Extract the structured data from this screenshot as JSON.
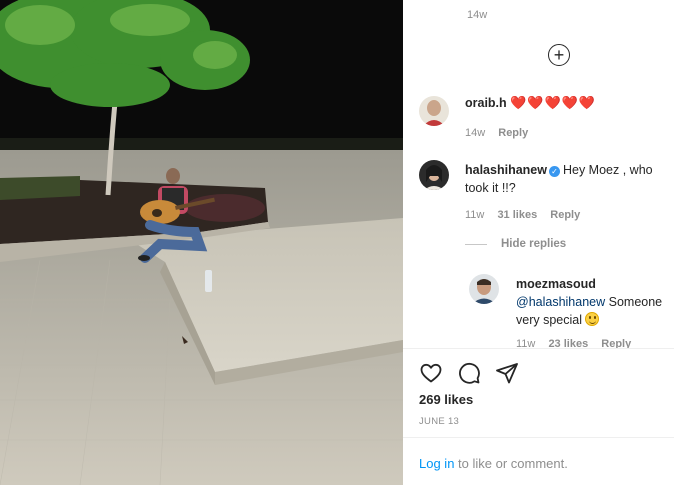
{
  "post": {
    "likes_count": "269 likes",
    "date": "JUNE 13"
  },
  "comments_panel": {
    "top_timestamp": "14w",
    "comments": [
      {
        "username": "oraib.h",
        "text": "❤️❤️❤️❤️❤️",
        "timestamp": "14w",
        "reply_label": "Reply"
      },
      {
        "username": "halashihanew",
        "verified": true,
        "text": "Hey Moez , who took it !!?",
        "timestamp": "11w",
        "likes": "31 likes",
        "reply_label": "Reply",
        "hide_replies_label": "Hide replies",
        "replies": [
          {
            "username": "moezmasoud",
            "mention": "@halashihanew",
            "text": " Someone very special",
            "timestamp": "11w",
            "likes": "23 likes",
            "reply_label": "Reply"
          }
        ]
      }
    ]
  },
  "footer": {
    "login_link": "Log in",
    "login_suffix": " to like or comment."
  },
  "icons": {
    "load_more": "plus-circle-icon",
    "like": "heart-outline-icon",
    "comment": "comment-bubble-icon",
    "share": "paper-plane-icon"
  },
  "colors": {
    "link": "#0095f6",
    "mention": "#00376b",
    "verified": "#3897f0",
    "heart": "#ed4956",
    "secondary_text": "#8e8e8e"
  }
}
